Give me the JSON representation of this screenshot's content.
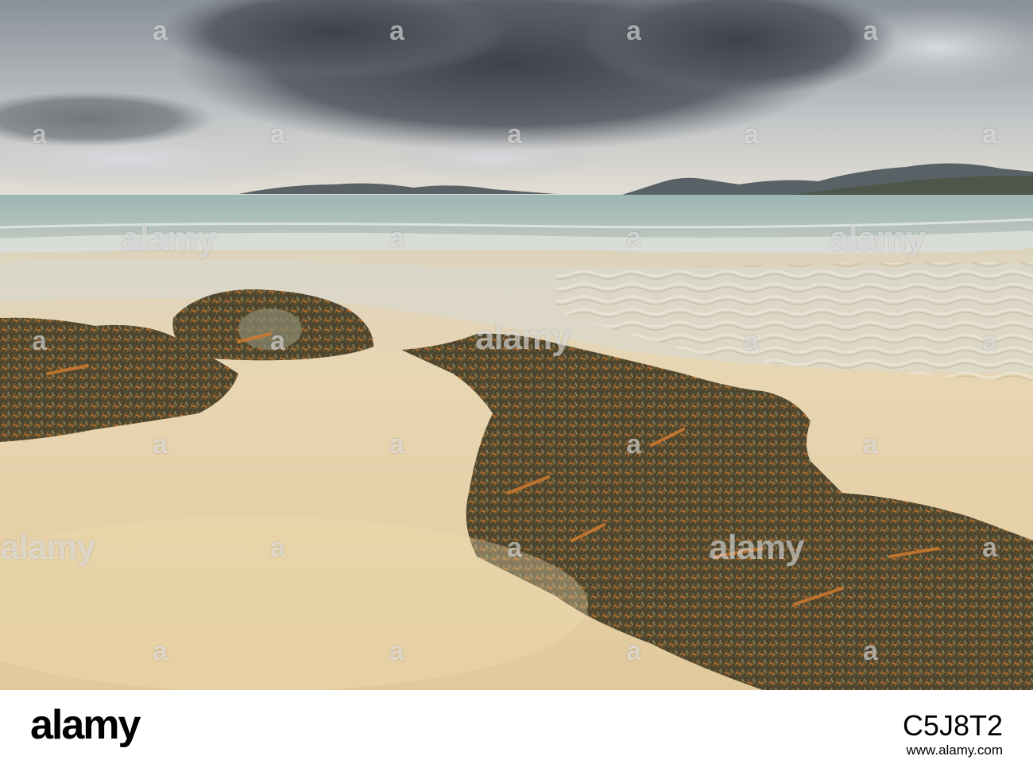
{
  "photo": {
    "subject": "sandy beach with seaweed-covered rocks under a stormy sky",
    "palette": {
      "sky_top": "#8e959c",
      "cloud_dark": "#4a4d54",
      "sea": "#9fb5b3",
      "sand": "#e6d3ae",
      "seaweed": "#5a4a2c",
      "seaweed_orange": "#c8702a"
    }
  },
  "watermark": {
    "logo": "alamy",
    "mark": "a"
  },
  "footer": {
    "logo": "alamy",
    "image_id": "C5J8T2",
    "url": "www.alamy.com"
  }
}
